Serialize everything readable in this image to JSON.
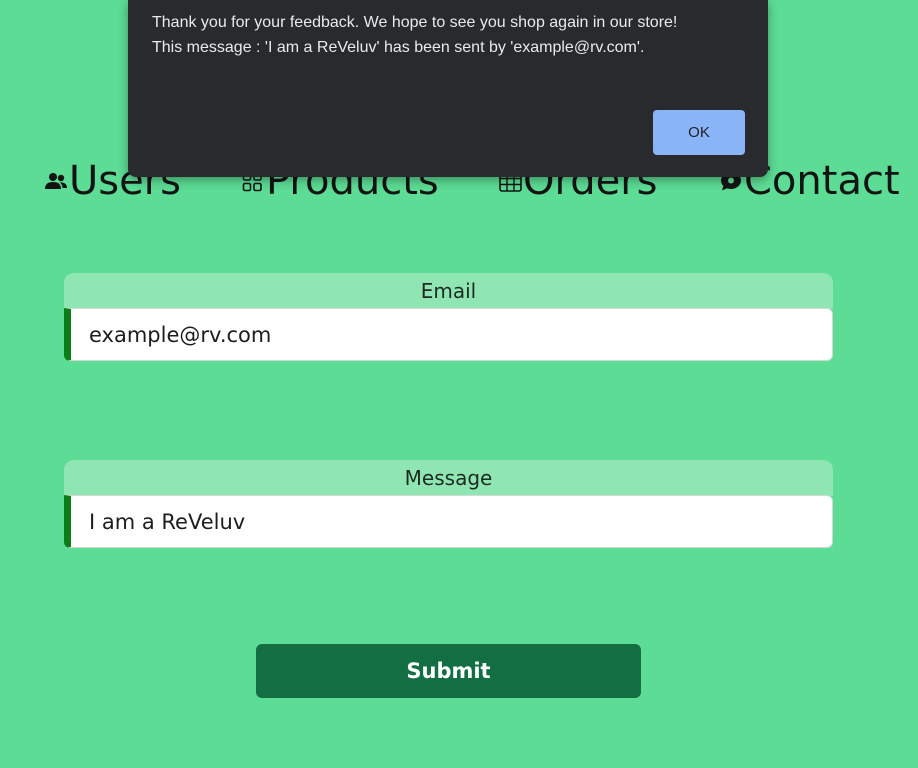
{
  "alert": {
    "line1": "Thank you for your feedback. We hope to see you shop again in our store!",
    "line2": "This message : 'I am a ReVeluv' has been sent by 'example@rv.com'.",
    "ok_label": "OK",
    "accent_color": "#8ab4f8"
  },
  "nav": {
    "items": [
      {
        "label": "Users",
        "icon": "users-icon"
      },
      {
        "label": "Products",
        "icon": "grid-icon"
      },
      {
        "label": "Orders",
        "icon": "table-icon"
      },
      {
        "label": "Contact",
        "icon": "chat-icon"
      }
    ]
  },
  "form": {
    "email": {
      "label": "Email",
      "value": "example@rv.com"
    },
    "message": {
      "label": "Message",
      "value": "I am a ReVeluv"
    },
    "submit_label": "Submit"
  },
  "colors": {
    "page_background": "#5cdc94",
    "label_background": "#8fe6b3",
    "input_accent": "#0a7d19",
    "submit_background": "#136e44"
  }
}
